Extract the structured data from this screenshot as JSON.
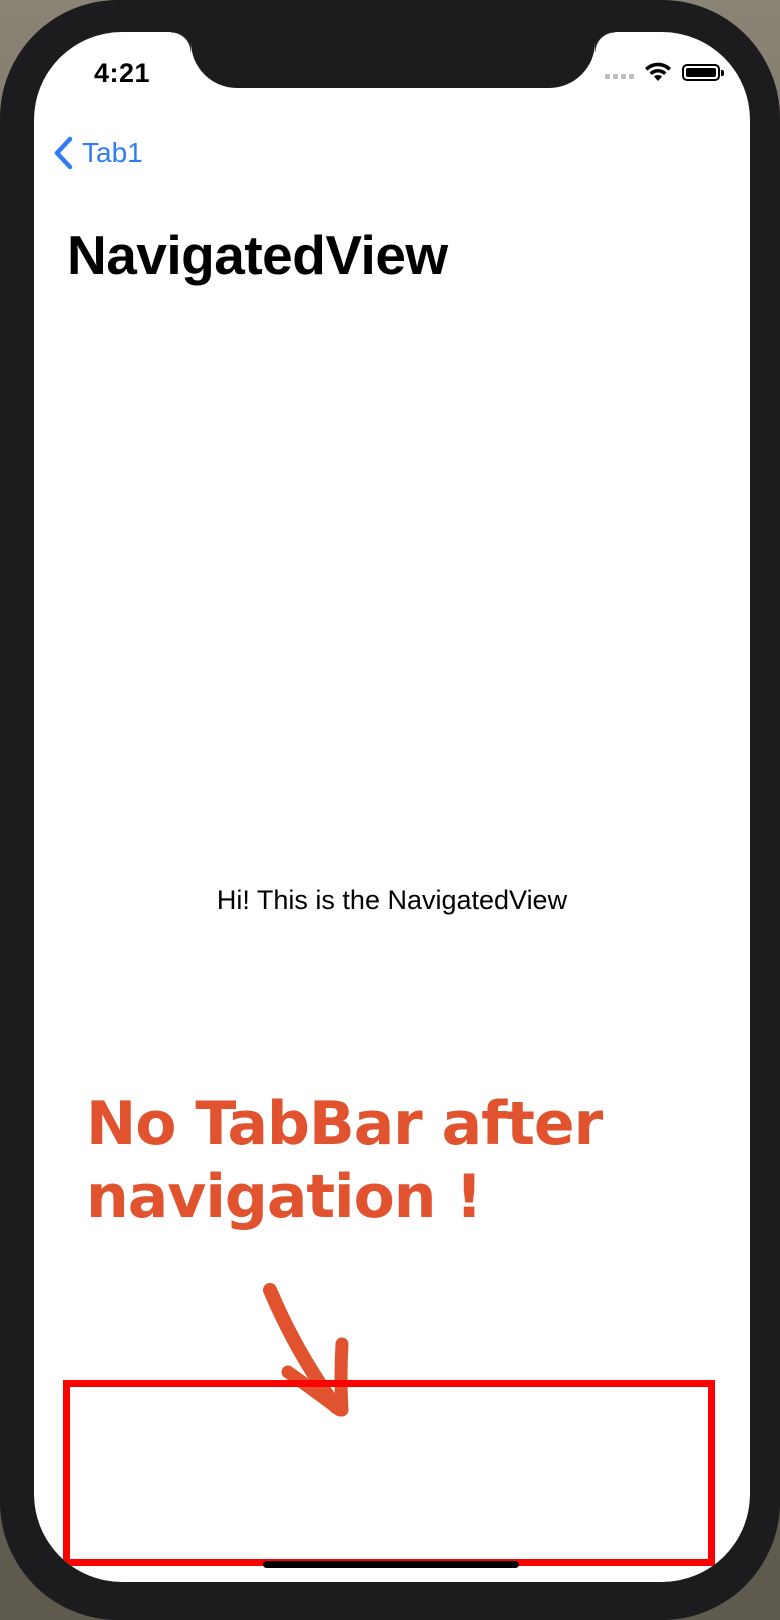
{
  "status_bar": {
    "time": "4:21"
  },
  "nav": {
    "back_label": "Tab1",
    "title": "NavigatedView"
  },
  "content": {
    "message": "Hi! This is the NavigatedView"
  },
  "annotation": {
    "line1": "No TabBar after",
    "line2": "navigation !"
  },
  "colors": {
    "accent": "#2f7cf6",
    "annotation": "#e0532e",
    "highlight": "#ff0000"
  },
  "icons": {
    "back": "chevron-left-icon",
    "wifi": "wifi-icon",
    "battery": "battery-icon",
    "signal": "signal-icon"
  }
}
